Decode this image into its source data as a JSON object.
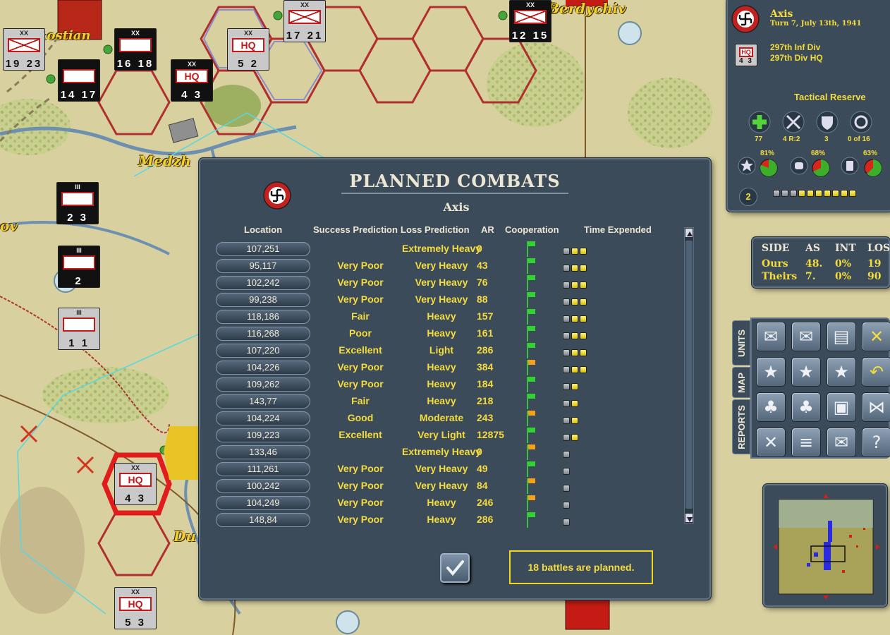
{
  "map": {
    "labels": [
      "Medzh",
      "Berdychiv",
      "ov",
      "Du",
      "kostian"
    ],
    "units": [
      {
        "id": "u1",
        "top": "XX",
        "mid": "",
        "bot": "19 23",
        "style": "grey-inf"
      },
      {
        "id": "u2",
        "top": "XX",
        "mid": "",
        "bot": "16 18",
        "style": "black-armor"
      },
      {
        "id": "u3",
        "top": "XX",
        "mid": "HQ",
        "bot": "5 2",
        "style": "grey-hq"
      },
      {
        "id": "u4",
        "top": "XX",
        "mid": "",
        "bot": "17 21",
        "style": "grey-inf"
      },
      {
        "id": "u5",
        "top": "XX",
        "mid": "HQ",
        "bot": "4 3",
        "style": "black-hq"
      },
      {
        "id": "u6",
        "top": "",
        "mid": "",
        "bot": "14 17",
        "style": "black-armor"
      },
      {
        "id": "u7",
        "top": "III",
        "mid": "",
        "bot": "2 3",
        "style": "black-armor"
      },
      {
        "id": "u8",
        "top": "III",
        "mid": "",
        "bot": "2",
        "style": "black-armor"
      },
      {
        "id": "u9",
        "top": "III",
        "mid": "",
        "bot": "1 1",
        "style": "grey-eng"
      },
      {
        "id": "u10",
        "top": "XX",
        "mid": "HQ",
        "bot": "4 3",
        "style": "grey-hq"
      },
      {
        "id": "u11",
        "top": "XX",
        "mid": "HQ",
        "bot": "5 3",
        "style": "grey-hq"
      },
      {
        "id": "u12",
        "top": "XX",
        "mid": "",
        "bot": "12 15",
        "style": "black-inf"
      }
    ]
  },
  "dialog": {
    "title": "PLANNED COMBATS",
    "side": "Axis",
    "columns": {
      "location": "Location",
      "success": "Success Prediction",
      "loss": "Loss Prediction",
      "ar": "AR",
      "coop": "Cooperation",
      "time": "Time Expended"
    },
    "rows": [
      {
        "location": "107,251",
        "success": "",
        "loss": "Extremely Heavy",
        "ar": "0",
        "coop": "green",
        "time": [
          "g",
          "y",
          "y"
        ]
      },
      {
        "location": "95,117",
        "success": "Very Poor",
        "loss": "Very Heavy",
        "ar": "43",
        "coop": "green",
        "time": [
          "g",
          "y",
          "y"
        ]
      },
      {
        "location": "102,242",
        "success": "Very Poor",
        "loss": "Very Heavy",
        "ar": "76",
        "coop": "green",
        "time": [
          "g",
          "y",
          "y"
        ]
      },
      {
        "location": "99,238",
        "success": "Very Poor",
        "loss": "Very Heavy",
        "ar": "88",
        "coop": "green",
        "time": [
          "g",
          "y",
          "y"
        ]
      },
      {
        "location": "118,186",
        "success": "Fair",
        "loss": "Heavy",
        "ar": "157",
        "coop": "green",
        "time": [
          "g",
          "y",
          "y"
        ]
      },
      {
        "location": "116,268",
        "success": "Poor",
        "loss": "Heavy",
        "ar": "161",
        "coop": "green",
        "time": [
          "g",
          "y",
          "y"
        ]
      },
      {
        "location": "107,220",
        "success": "Excellent",
        "loss": "Light",
        "ar": "286",
        "coop": "green",
        "time": [
          "g",
          "y",
          "y"
        ]
      },
      {
        "location": "104,226",
        "success": "Very Poor",
        "loss": "Heavy",
        "ar": "384",
        "coop": "orange",
        "time": [
          "g",
          "y",
          "y"
        ]
      },
      {
        "location": "109,262",
        "success": "Very Poor",
        "loss": "Heavy",
        "ar": "184",
        "coop": "green",
        "time": [
          "g",
          "y"
        ]
      },
      {
        "location": "143,77",
        "success": "Fair",
        "loss": "Heavy",
        "ar": "218",
        "coop": "green",
        "time": [
          "g",
          "y"
        ]
      },
      {
        "location": "104,224",
        "success": "Good",
        "loss": "Moderate",
        "ar": "243",
        "coop": "orange",
        "time": [
          "g",
          "y"
        ]
      },
      {
        "location": "109,223",
        "success": "Excellent",
        "loss": "Very Light",
        "ar": "12875",
        "coop": "green",
        "time": [
          "g",
          "y"
        ]
      },
      {
        "location": "133,46",
        "success": "",
        "loss": "Extremely Heavy",
        "ar": "0",
        "coop": "orange",
        "time": [
          "g"
        ]
      },
      {
        "location": "111,261",
        "success": "Very Poor",
        "loss": "Very Heavy",
        "ar": "49",
        "coop": "green",
        "time": [
          "g"
        ]
      },
      {
        "location": "100,242",
        "success": "Very Poor",
        "loss": "Very Heavy",
        "ar": "84",
        "coop": "orange",
        "time": [
          "g"
        ]
      },
      {
        "location": "104,249",
        "success": "Very Poor",
        "loss": "Heavy",
        "ar": "246",
        "coop": "orange",
        "time": [
          "g"
        ]
      },
      {
        "location": "148,84",
        "success": "Very Poor",
        "loss": "Heavy",
        "ar": "286",
        "coop": "green",
        "time": [
          "g"
        ]
      }
    ],
    "status": "18 battles are planned."
  },
  "info": {
    "side": "Axis",
    "turn": "Turn 7, July 13th, 1941",
    "unit_line1": "297th Inf Div",
    "unit_line2": "297th Div HQ",
    "counter_bot": "4 3",
    "tactical_reserve_title": "Tactical Reserve",
    "reserve_values": [
      "77",
      "4 R:2",
      "3",
      "0 of 16"
    ],
    "percents": [
      "81%",
      "68%",
      "63%"
    ],
    "badge": "2",
    "progress_total": 10,
    "progress_filled": 7
  },
  "stats": {
    "headers": [
      "SIDE",
      "AS",
      "INT",
      "LOST"
    ],
    "ours": [
      "Ours",
      "48.",
      "0%",
      "19"
    ],
    "theirs": [
      "Theirs",
      "7.",
      "0%",
      "90"
    ]
  },
  "tabs": [
    "UNITS",
    "MAP",
    "REPORTS"
  ],
  "colors": {
    "accent": "#f5dc3c",
    "panel": "#3b4b5a",
    "coop_green": "#2fd32f",
    "coop_orange": "#f5a01a"
  }
}
